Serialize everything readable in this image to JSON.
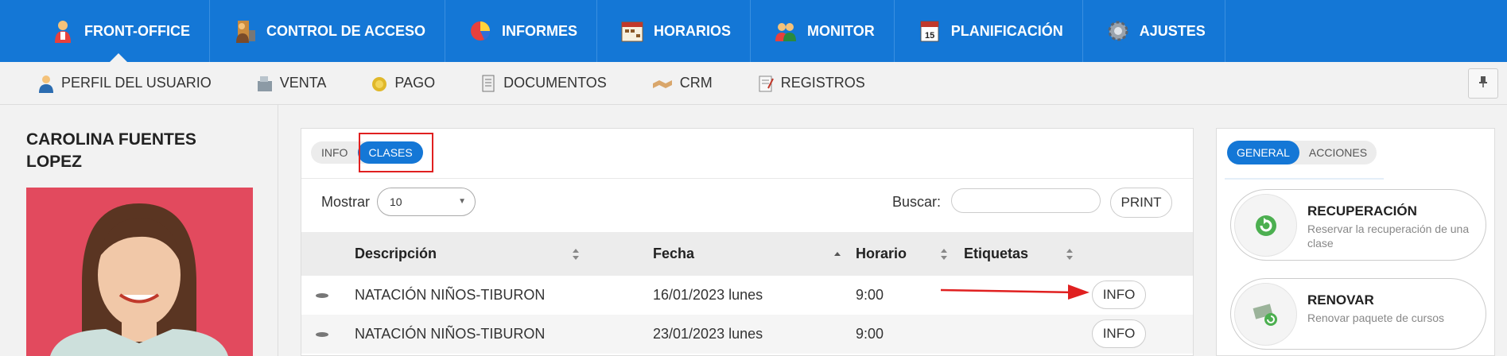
{
  "topnav": {
    "items": [
      {
        "label": "FRONT-OFFICE",
        "icon": "user-icon",
        "active": true
      },
      {
        "label": "CONTROL DE ACCESO",
        "icon": "access-control-icon"
      },
      {
        "label": "INFORMES",
        "icon": "pie-chart-icon"
      },
      {
        "label": "HORARIOS",
        "icon": "schedule-icon"
      },
      {
        "label": "MONITOR",
        "icon": "monitor-users-icon"
      },
      {
        "label": "PLANIFICACIÓN",
        "icon": "calendar-icon"
      },
      {
        "label": "AJUSTES",
        "icon": "gear-icon"
      }
    ]
  },
  "subnav": {
    "items": [
      {
        "label": "PERFIL DEL USUARIO",
        "icon": "user-profile-icon"
      },
      {
        "label": "VENTA",
        "icon": "cash-register-icon"
      },
      {
        "label": "PAGO",
        "icon": "coin-icon"
      },
      {
        "label": "DOCUMENTOS",
        "icon": "document-icon"
      },
      {
        "label": "CRM",
        "icon": "handshake-icon"
      },
      {
        "label": "REGISTROS",
        "icon": "log-icon"
      }
    ]
  },
  "user": {
    "name": "CAROLINA FUENTES LOPEZ"
  },
  "main": {
    "tabs": [
      {
        "label": "INFO"
      },
      {
        "label": "CLASES",
        "active": true
      }
    ],
    "show_label": "Mostrar",
    "show_value": "10",
    "search_label": "Buscar:",
    "search_value": "",
    "print_label": "PRINT",
    "columns": [
      "Descripción",
      "Fecha",
      "Horario",
      "Etiquetas"
    ],
    "rows": [
      {
        "description": "NATACIÓN NIÑOS-TIBURON",
        "date": "16/01/2023 lunes",
        "time": "9:00",
        "tags": "",
        "button": "INFO"
      },
      {
        "description": "NATACIÓN NIÑOS-TIBURON",
        "date": "23/01/2023 lunes",
        "time": "9:00",
        "tags": "",
        "button": "INFO"
      }
    ]
  },
  "right": {
    "tabs": [
      {
        "label": "GENERAL",
        "active": true
      },
      {
        "label": "ACCIONES"
      }
    ],
    "actions": [
      {
        "title": "RECUPERACIÓN",
        "desc": "Reservar la recuperación de una clase",
        "icon": "refresh-icon"
      },
      {
        "title": "RENOVAR",
        "desc": "Renovar paquete de cursos",
        "icon": "renew-money-icon"
      }
    ]
  },
  "colors": {
    "brand": "#1477d6",
    "highlight": "#e02020"
  }
}
